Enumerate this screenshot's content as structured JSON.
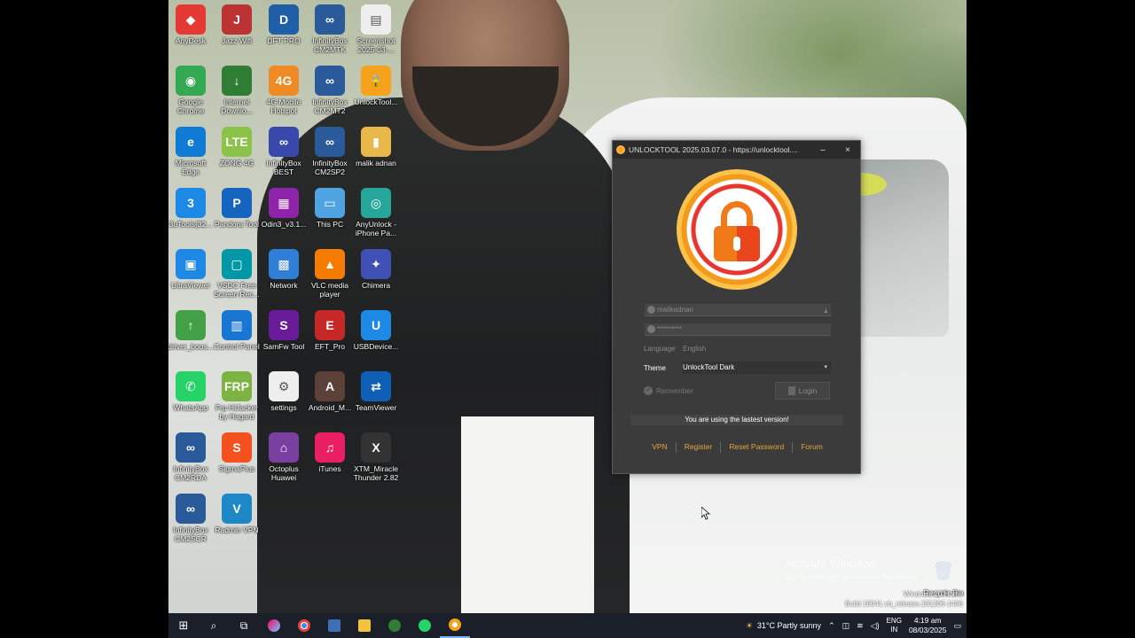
{
  "desktop_icons": [
    {
      "label": "AnyDesk",
      "color": "#e53935",
      "glyph": "◆"
    },
    {
      "label": "Jazz Wifi",
      "color": "#b33",
      "glyph": "J"
    },
    {
      "label": "DFT PRO",
      "color": "#1e5fa8",
      "glyph": "D"
    },
    {
      "label": "InfinityBox CM2MTK",
      "color": "#2a5a9a",
      "glyph": "∞"
    },
    {
      "label": "Screenshot 2025-03-...",
      "color": "#eee",
      "glyph": "▤"
    },
    {
      "label": "Google Chrome",
      "color": "#34a853",
      "glyph": "◉"
    },
    {
      "label": "Internet Downlo...",
      "color": "#2e7d32",
      "glyph": "↓"
    },
    {
      "label": "4G Mobile Hotspot",
      "color": "#f08a24",
      "glyph": "4G"
    },
    {
      "label": "InfinityBox CM2MT2",
      "color": "#2a5a9a",
      "glyph": "∞"
    },
    {
      "label": "UnlockTool...",
      "color": "#f7a21b",
      "glyph": "🔒"
    },
    {
      "label": "Microsoft Edge",
      "color": "#0f7bd4",
      "glyph": "e"
    },
    {
      "label": "ZONG 4G",
      "color": "#8bc34a",
      "glyph": "LTE"
    },
    {
      "label": "InfinityBox BEST",
      "color": "#3949ab",
      "glyph": "∞"
    },
    {
      "label": "InfinityBox CM2SP2",
      "color": "#2a5a9a",
      "glyph": "∞"
    },
    {
      "label": "malik adnan",
      "color": "#e8b84a",
      "glyph": "▮"
    },
    {
      "label": "3uTools(32...",
      "color": "#1e88e5",
      "glyph": "3"
    },
    {
      "label": "Pandora Tool",
      "color": "#1565c0",
      "glyph": "P"
    },
    {
      "label": "Odin3_v3.1...",
      "color": "#8e24aa",
      "glyph": "▦"
    },
    {
      "label": "This PC",
      "color": "#4fa3e0",
      "glyph": "▭"
    },
    {
      "label": "AnyUnlock - iPhone Pa...",
      "color": "#26a69a",
      "glyph": "◎"
    },
    {
      "label": "UltraViewer",
      "color": "#1e88e5",
      "glyph": "▣"
    },
    {
      "label": "VSDC Free Screen Rec...",
      "color": "#0097a7",
      "glyph": "▢"
    },
    {
      "label": "Network",
      "color": "#2f7fd6",
      "glyph": "▩"
    },
    {
      "label": "VLC media player",
      "color": "#f57c00",
      "glyph": "▲"
    },
    {
      "label": "Chimera",
      "color": "#3f51b5",
      "glyph": "✦"
    },
    {
      "label": "driver_boos...",
      "color": "#43a047",
      "glyph": "↑"
    },
    {
      "label": "Control Panel",
      "color": "#1976d2",
      "glyph": "▥"
    },
    {
      "label": "SamFw Tool",
      "color": "#6a1b9a",
      "glyph": "S"
    },
    {
      "label": "EFT_Pro",
      "color": "#c62828",
      "glyph": "E"
    },
    {
      "label": "USBDevice...",
      "color": "#1e88e5",
      "glyph": "U"
    },
    {
      "label": "WhatsApp",
      "color": "#25d366",
      "glyph": "✆"
    },
    {
      "label": "Frp HiJacker by Hagard",
      "color": "#7cb342",
      "glyph": "FRP"
    },
    {
      "label": "settings",
      "color": "#eeeeee",
      "glyph": "⚙"
    },
    {
      "label": "Android_M...",
      "color": "#5d4037",
      "glyph": "A"
    },
    {
      "label": "TeamViewer",
      "color": "#0e5fb5",
      "glyph": "⇄"
    },
    {
      "label": "InfinityBox CM2RDA",
      "color": "#2a5a9a",
      "glyph": "∞"
    },
    {
      "label": "SigmaPlus",
      "color": "#f4511e",
      "glyph": "S"
    },
    {
      "label": "Octoplus Huawei",
      "color": "#7b3fa0",
      "glyph": "⌂"
    },
    {
      "label": "iTunes",
      "color": "#e91e63",
      "glyph": "♫"
    },
    {
      "label": "XTM_Miracle Thunder 2.82",
      "color": "#333333",
      "glyph": "X"
    },
    {
      "label": "InfinityBox CM2SCR",
      "color": "#2a5a9a",
      "glyph": "∞"
    },
    {
      "label": "Radmin VPN",
      "color": "#1e88c7",
      "glyph": "V"
    }
  ],
  "recycle_bin": {
    "label": "Recycle Bin"
  },
  "app": {
    "title": "UNLOCKTOOL 2025.03.07.0 - https://unlocktool....",
    "minimize": "–",
    "close": "×",
    "username": "malikadnan",
    "password": "*********",
    "language_label": "Language",
    "language_value": "English",
    "theme_label": "Theme",
    "theme_value": "UnlockTool Dark",
    "remember_label": "Remember",
    "login_label": "Login",
    "status": "You are using the lastest version!",
    "links": [
      "VPN",
      "Register",
      "Reset Password",
      "Forum"
    ]
  },
  "watermark": {
    "line1": "Activate Windows",
    "line2": "Go to Settings to activate Windows."
  },
  "build": {
    "line1": "Windows 10 Home",
    "line2": "Build 19041.vb_release.191206-1406"
  },
  "taskbar": {
    "weather": "31°C  Partly sunny",
    "lang_top": "ENG",
    "lang_bottom": "IN",
    "time": "4:19 am",
    "date": "08/03/2025"
  }
}
